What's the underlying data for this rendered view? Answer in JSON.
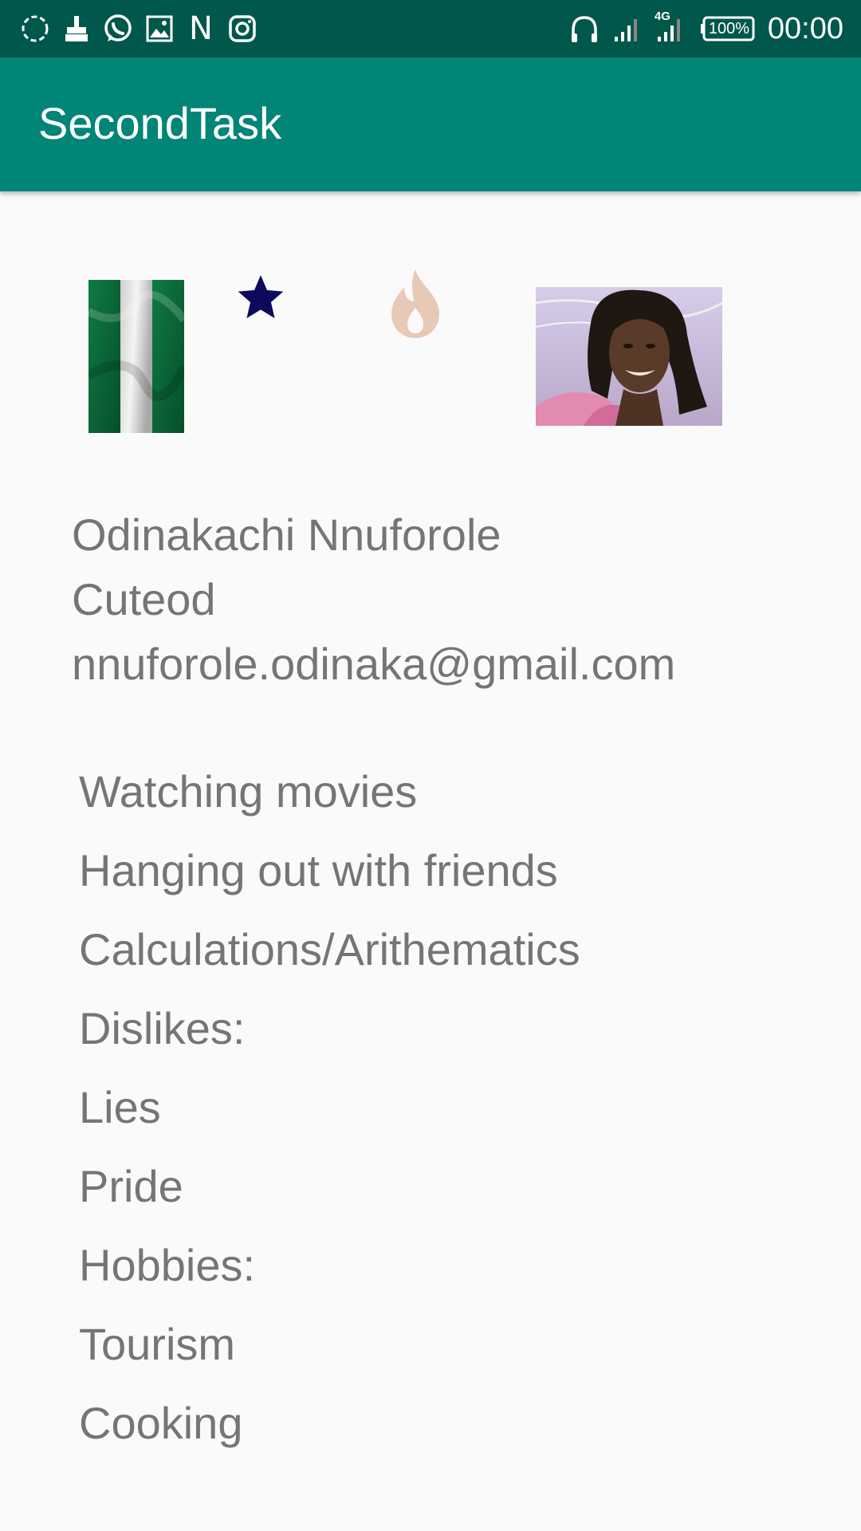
{
  "status_bar": {
    "time": "00:00",
    "battery": "100%",
    "network": "4G",
    "left_icons": [
      "sync-icon",
      "cleaner-icon",
      "whatsapp-icon",
      "gallery-icon",
      "n-icon",
      "instagram-icon"
    ],
    "left_icon_n": "N"
  },
  "app_bar": {
    "title": "SecondTask",
    "color": "#008577",
    "status_color": "#00574b"
  },
  "icons": {
    "star_color": "#0d0a5c",
    "flame_color": "#e8c9b5"
  },
  "profile": {
    "name": "Odinakachi Nnuforole",
    "nickname": "Cuteod",
    "email": "nnuforole.odinaka@gmail.com"
  },
  "list_items": [
    "Watching movies",
    "Hanging out with friends",
    "Calculations/Arithematics",
    "Dislikes:",
    "Lies",
    "Pride",
    "Hobbies:",
    "Tourism",
    "Cooking"
  ]
}
